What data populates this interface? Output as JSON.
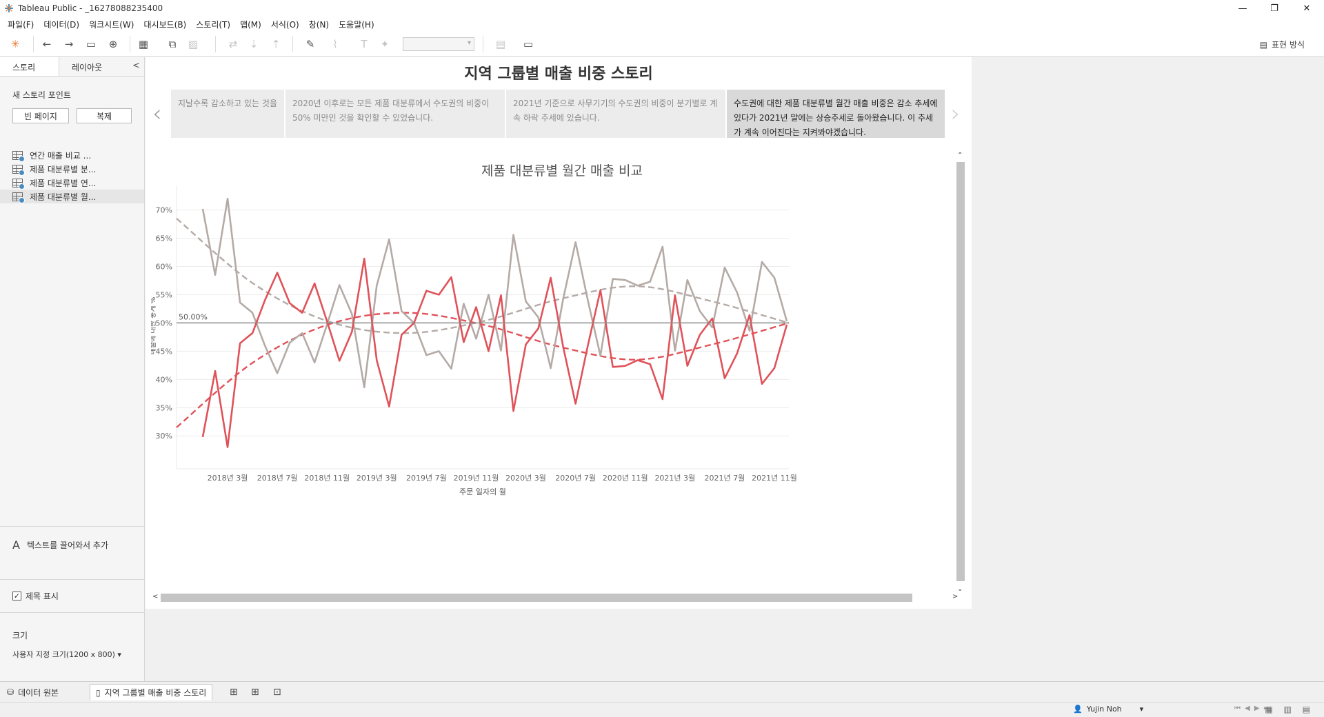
{
  "window": {
    "title": "Tableau Public - _16278088235400"
  },
  "menu": [
    "파일(F)",
    "데이터(D)",
    "워크시트(W)",
    "대시보드(B)",
    "스토리(T)",
    "맵(M)",
    "서식(O)",
    "창(N)",
    "도움말(H)"
  ],
  "toolbar": {
    "show_me": "표현 방식"
  },
  "sidebar": {
    "tabs": [
      "스토리",
      "레이아웃"
    ],
    "new_point_label": "새 스토리 포인트",
    "blank_btn": "빈 페이지",
    "duplicate_btn": "복제",
    "sheets": [
      "연간 매출 비교 ...",
      "제품 대분류별 분...",
      "제품 대분류별 연...",
      "제품 대분류별 월..."
    ],
    "drag_text": "텍스트를 끌어와서 추가",
    "show_title": "제목 표시",
    "size_label": "크기",
    "size_value": "사용자 지정 크기(1200 x 800)"
  },
  "story": {
    "title": "지역 그룹별 매출 비중 스토리",
    "points": [
      "지날수록 감소하고 있는 것을",
      "2020년 이후로는 모든 제품 대분류에서 수도권의 비중이 50% 미만인 것을 확인할 수 있었습니다.",
      "2021년 기준으로 사무기기의 수도권의 비중이 분기별로 계속 하락 추세에 있습니다.",
      "수도권에 대한 제품 대분류별 월간 매출 비중은 감소 추세에 있다가 2021년 말에는 상승추세로 돌아왔습니다. 이 추세가 계속 이어진다는 지켜봐야겠습니다."
    ]
  },
  "chart_data": {
    "type": "line",
    "title": "제품 대분류별 월간 매출 비교",
    "xlabel": "주문 일자의 월",
    "ylabel": "매출에 대한 총계 %",
    "x_tick_labels": [
      "2018년 3월",
      "2018년 7월",
      "2018년 11월",
      "2019년 3월",
      "2019년 7월",
      "2019년 11월",
      "2020년 3월",
      "2020년 7월",
      "2020년 11월",
      "2021년 3월",
      "2021년 7월",
      "2021년 11월"
    ],
    "y_tick_labels": [
      "30%",
      "35%",
      "40%",
      "45%",
      "50%",
      "55%",
      "60%",
      "65%",
      "70%"
    ],
    "ylim": [
      26,
      73
    ],
    "reference_line": {
      "value": 50,
      "label": "50.00%"
    },
    "x_start": "2018-01",
    "series": [
      {
        "color": "#b4aaa6",
        "values": [
          70.2,
          58.5,
          72.0,
          53.6,
          51.8,
          46.0,
          41.1,
          46.5,
          48.2,
          43.0,
          49.7,
          56.7,
          51.6,
          38.6,
          56.6,
          64.8,
          52.1,
          50.0,
          44.3,
          45.0,
          41.9,
          53.4,
          47.2,
          55.0,
          45.1,
          65.6,
          53.8,
          51.0,
          42.0,
          54.2,
          64.3,
          53.9,
          44.2,
          57.8,
          57.6,
          56.6,
          57.3,
          63.5,
          45.1,
          57.6,
          52.1,
          49.2,
          59.8,
          55.4,
          48.6,
          60.8,
          58.0,
          50.3
        ]
      },
      {
        "color": "#e05259",
        "values": [
          29.8,
          41.5,
          28.0,
          46.4,
          48.2,
          54.0,
          58.9,
          53.5,
          51.8,
          57.0,
          50.3,
          43.3,
          48.4,
          61.4,
          43.4,
          35.2,
          47.9,
          50.0,
          55.7,
          55.0,
          58.1,
          46.6,
          52.8,
          45.0,
          54.9,
          34.4,
          46.2,
          49.0,
          58.0,
          45.8,
          35.7,
          46.1,
          55.8,
          42.2,
          42.4,
          43.4,
          42.7,
          36.5,
          54.9,
          42.4,
          47.9,
          50.8,
          40.2,
          44.6,
          51.4,
          39.2,
          42.0,
          49.7
        ]
      }
    ],
    "trend_lines": [
      {
        "color": "#b4aaa6",
        "style": "dashed",
        "values": [
          68.5,
          57.0,
          50.2,
          48.2,
          50.3,
          54.2,
          56.5,
          53.8,
          50.0
        ]
      },
      {
        "color": "#e05259",
        "style": "dashed",
        "values": [
          31.5,
          43.0,
          49.8,
          51.8,
          49.7,
          45.8,
          43.5,
          46.2,
          50.0
        ]
      }
    ]
  },
  "bottom": {
    "data_source_tab": "데이터 원본",
    "story_tab": "지역 그룹별 매출 비중 스토리"
  },
  "status": {
    "user": "Yujin Noh"
  }
}
